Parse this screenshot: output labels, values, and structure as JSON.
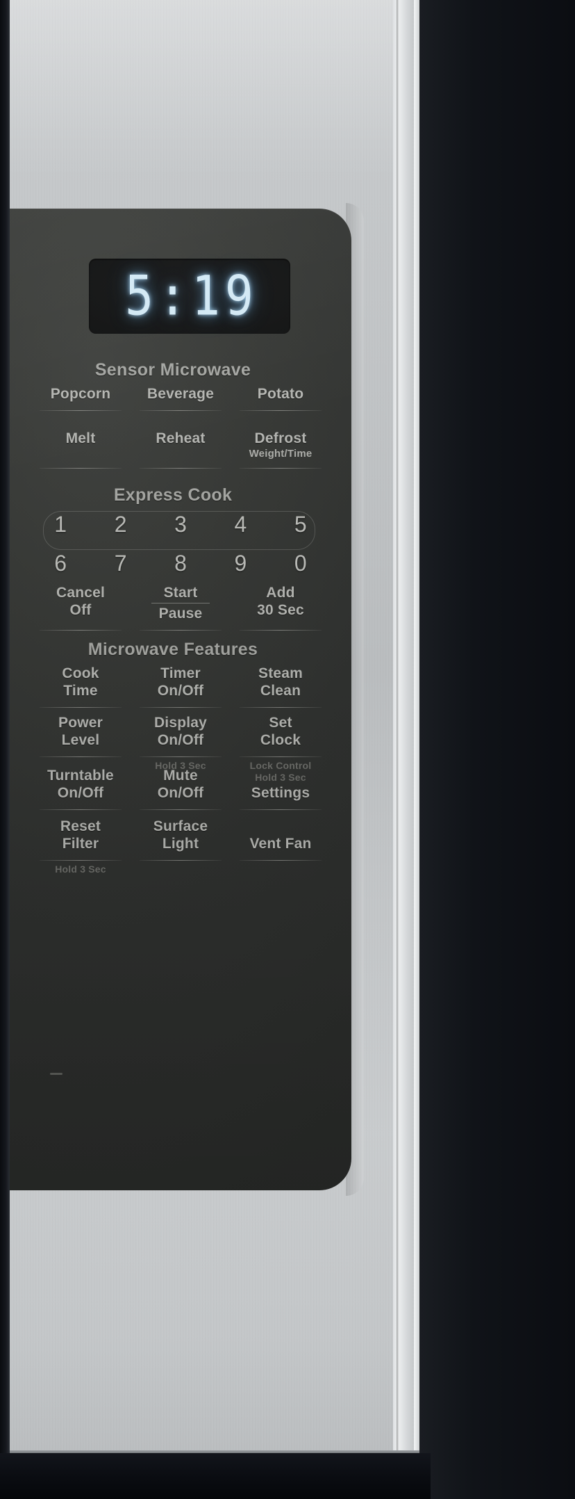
{
  "appliance": {
    "type": "over-the-range-microwave",
    "finish_color": "#c4c7c9",
    "glass_panel_color": "#353734",
    "accent_color": "#d6ecf8"
  },
  "display": {
    "name": "led-clock-display",
    "value": "5:19",
    "color": "#d6ecf8"
  },
  "sections": [
    {
      "id": "sensor-microwave",
      "title": "Sensor Microwave",
      "rows": [
        [
          {
            "line1": "Popcorn",
            "line2": "",
            "hint": ""
          },
          {
            "line1": "Beverage",
            "line2": "",
            "hint": ""
          },
          {
            "line1": "Potato",
            "line2": "",
            "hint": ""
          }
        ],
        [
          {
            "line1": "Melt",
            "line2": "",
            "hint": ""
          },
          {
            "line1": "Reheat",
            "line2": "",
            "hint": ""
          },
          {
            "line1": "Defrost",
            "line2": "Weight/Time",
            "hint": ""
          }
        ]
      ]
    },
    {
      "id": "express-cook",
      "title": "Express Cook",
      "keypad_row1": [
        "1",
        "2",
        "3",
        "4",
        "5"
      ],
      "keypad_row2": [
        "6",
        "7",
        "8",
        "9",
        "0"
      ],
      "rows": [
        [
          {
            "line1": "Cancel",
            "line2": "Off",
            "hint": ""
          },
          {
            "line1": "Start",
            "line2": "Pause",
            "hint": "",
            "divider": true
          },
          {
            "line1": "Add",
            "line2": "30 Sec",
            "hint": ""
          }
        ]
      ]
    },
    {
      "id": "microwave-features",
      "title": "Microwave Features",
      "rows": [
        [
          {
            "line1": "Cook",
            "line2": "Time",
            "hint": ""
          },
          {
            "line1": "Timer",
            "line2": "On/Off",
            "hint": ""
          },
          {
            "line1": "Steam",
            "line2": "Clean",
            "hint": ""
          }
        ],
        [
          {
            "line1": "Power",
            "line2": "Level",
            "hint": ""
          },
          {
            "line1": "Display",
            "line2": "On/Off",
            "hint": "Hold 3 Sec"
          },
          {
            "line1": "Set",
            "line2": "Clock",
            "hint": "Lock Control\nHold 3 Sec"
          }
        ],
        [
          {
            "line1": "Turntable",
            "line2": "On/Off",
            "hint": ""
          },
          {
            "line1": "Mute",
            "line2": "On/Off",
            "hint": ""
          },
          {
            "line1": "Settings",
            "line2": "",
            "hint": ""
          }
        ],
        [
          {
            "line1": "Reset",
            "line2": "Filter",
            "hint": "Hold 3 Sec"
          },
          {
            "line1": "Surface",
            "line2": "Light",
            "hint": ""
          },
          {
            "line1": "Vent Fan",
            "line2": "",
            "hint": ""
          }
        ]
      ]
    }
  ]
}
